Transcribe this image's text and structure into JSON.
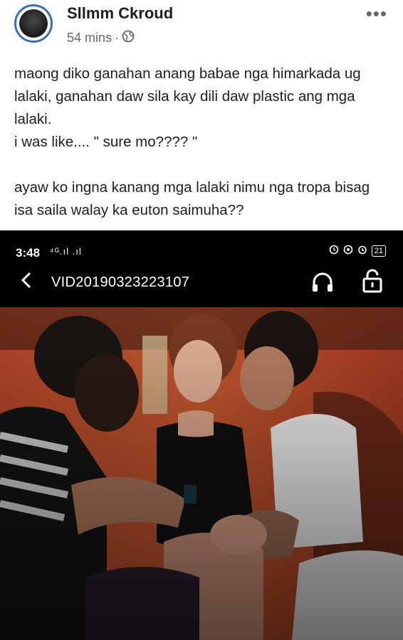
{
  "post": {
    "author": "Sllmm Ckroud",
    "time": "54 mins",
    "separator": "·",
    "text": "maong diko ganahan anang babae nga himarkada ug lalaki, ganahan daw sila kay dili daw plastic ang mga lalaki.\ni was like.... \" sure mo???? \"\n\nayaw ko ingna kanang mga lalaki nimu nga tropa bisag isa saila walay ka euton saimuha??",
    "more_label": "•••"
  },
  "phone": {
    "status_time": "3:48",
    "status_signal": "⁴ᴳ.ıl .ıl",
    "battery": "21",
    "file_title": "VID20190323223107"
  },
  "icons": {
    "globe": "globe-icon",
    "more": "more-icon",
    "back": "chevron-left-icon",
    "headphones": "headphones-icon",
    "lock": "unlock-icon"
  }
}
